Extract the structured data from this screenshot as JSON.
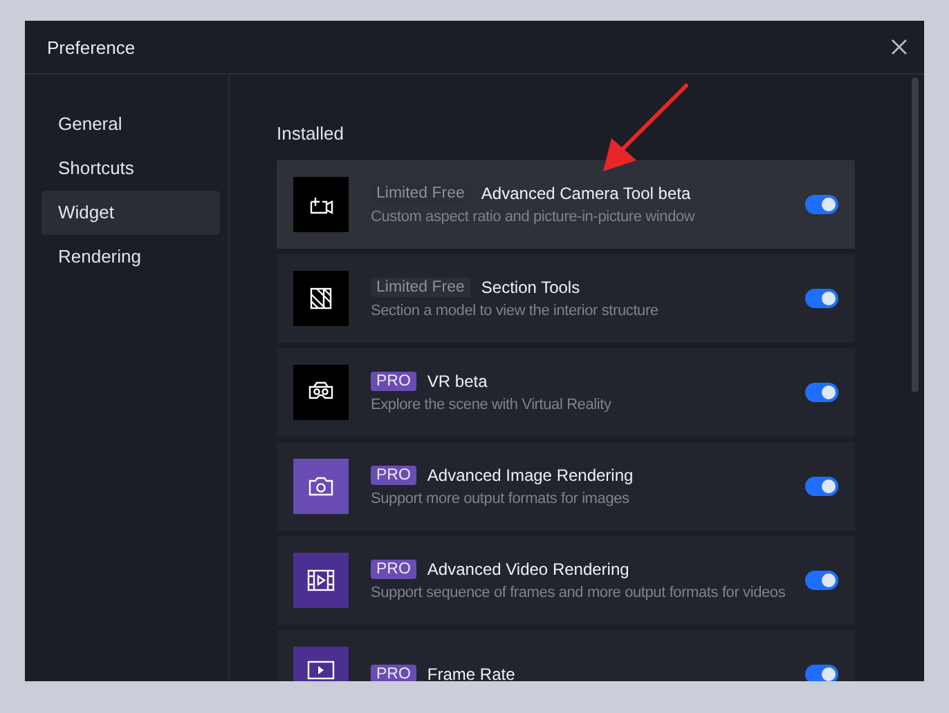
{
  "window": {
    "title": "Preference"
  },
  "sidebar": {
    "items": [
      {
        "label": "General",
        "selected": false
      },
      {
        "label": "Shortcuts",
        "selected": false
      },
      {
        "label": "Widget",
        "selected": true
      },
      {
        "label": "Rendering",
        "selected": false
      }
    ]
  },
  "section": {
    "title": "Installed"
  },
  "widgets": [
    {
      "badge": "Limited Free",
      "kind": "limited",
      "name": "Advanced Camera Tool beta",
      "description": "Custom aspect ratio and picture-in-picture window",
      "color": "#000000",
      "highlighted": true,
      "on": true
    },
    {
      "badge": "Limited Free",
      "kind": "limited",
      "name": "Section Tools",
      "description": "Section a model to view the interior structure",
      "color": "#000000",
      "highlighted": false,
      "on": true
    },
    {
      "badge": "PRO",
      "kind": "pro",
      "name": "VR beta",
      "description": "Explore the scene with Virtual Reality",
      "color": "#000000",
      "highlighted": false,
      "on": true
    },
    {
      "badge": "PRO",
      "kind": "pro",
      "name": "Advanced Image Rendering",
      "description": "Support more output formats for images",
      "color": "#6a4cb5",
      "highlighted": false,
      "on": true
    },
    {
      "badge": "PRO",
      "kind": "pro",
      "name": "Advanced Video Rendering",
      "description": "Support sequence of frames and more output formats for videos",
      "color": "#4b2f91",
      "highlighted": false,
      "on": true
    },
    {
      "badge": "PRO",
      "kind": "pro",
      "name": "Frame Rate",
      "color": "#4b2f91",
      "highlighted": false,
      "on": true
    }
  ]
}
